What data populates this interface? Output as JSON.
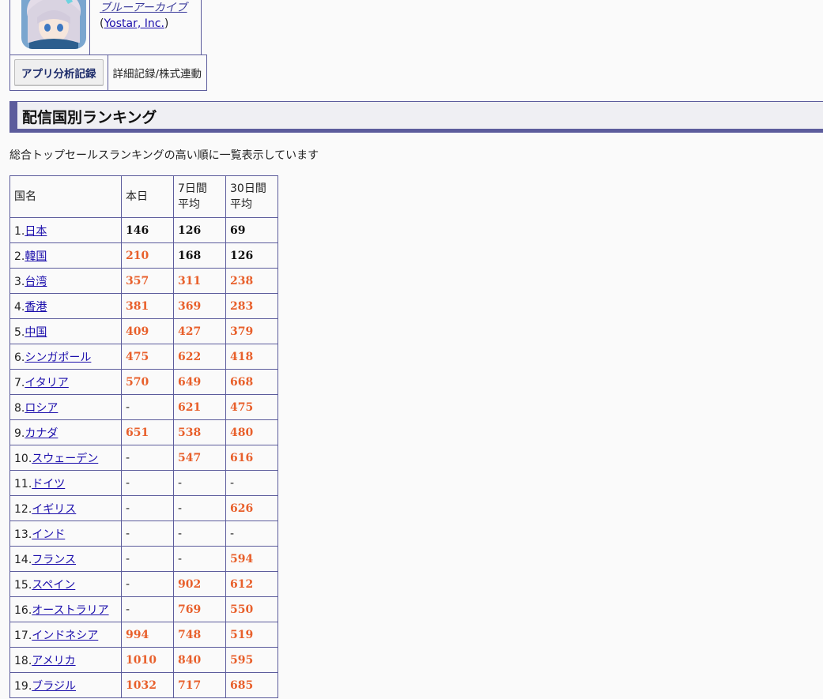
{
  "app": {
    "name": "ブルーアーカイブ",
    "publisher_open": "(",
    "publisher": "Yostar, Inc.",
    "publisher_close": ")"
  },
  "buttons": {
    "analysis_label": "アプリ分析記録",
    "detail_label": "詳細記録/株式連動"
  },
  "section": {
    "title": "配信国別ランキング",
    "description": "総合トップセールスランキングの高い順に一覧表示しています"
  },
  "table": {
    "headers": {
      "country": "国名",
      "today": "本日",
      "avg7_line1": "7日間",
      "avg7_line2": "平均",
      "avg30_line1": "30日間",
      "avg30_line2": "平均"
    },
    "rows": [
      {
        "rank": "1.",
        "country": "日本",
        "today": "146",
        "avg7": "126",
        "avg30": "69"
      },
      {
        "rank": "2.",
        "country": "韓国",
        "today": "210",
        "avg7": "168",
        "avg30": "126"
      },
      {
        "rank": "3.",
        "country": "台湾",
        "today": "357",
        "avg7": "311",
        "avg30": "238"
      },
      {
        "rank": "4.",
        "country": "香港",
        "today": "381",
        "avg7": "369",
        "avg30": "283"
      },
      {
        "rank": "5.",
        "country": "中国",
        "today": "409",
        "avg7": "427",
        "avg30": "379"
      },
      {
        "rank": "6.",
        "country": "シンガポール",
        "today": "475",
        "avg7": "622",
        "avg30": "418"
      },
      {
        "rank": "7.",
        "country": "イタリア",
        "today": "570",
        "avg7": "649",
        "avg30": "668"
      },
      {
        "rank": "8.",
        "country": "ロシア",
        "today": "-",
        "avg7": "621",
        "avg30": "475"
      },
      {
        "rank": "9.",
        "country": "カナダ",
        "today": "651",
        "avg7": "538",
        "avg30": "480"
      },
      {
        "rank": "10.",
        "country": "スウェーデン",
        "today": "-",
        "avg7": "547",
        "avg30": "616"
      },
      {
        "rank": "11.",
        "country": "ドイツ",
        "today": "-",
        "avg7": "-",
        "avg30": "-"
      },
      {
        "rank": "12.",
        "country": "イギリス",
        "today": "-",
        "avg7": "-",
        "avg30": "626"
      },
      {
        "rank": "13.",
        "country": "インド",
        "today": "-",
        "avg7": "-",
        "avg30": "-"
      },
      {
        "rank": "14.",
        "country": "フランス",
        "today": "-",
        "avg7": "-",
        "avg30": "594"
      },
      {
        "rank": "15.",
        "country": "スペイン",
        "today": "-",
        "avg7": "902",
        "avg30": "612"
      },
      {
        "rank": "16.",
        "country": "オーストラリア",
        "today": "-",
        "avg7": "769",
        "avg30": "550"
      },
      {
        "rank": "17.",
        "country": "インドネシア",
        "today": "994",
        "avg7": "748",
        "avg30": "519"
      },
      {
        "rank": "18.",
        "country": "アメリカ",
        "today": "1010",
        "avg7": "840",
        "avg30": "595"
      },
      {
        "rank": "19.",
        "country": "ブラジル",
        "today": "1032",
        "avg7": "717",
        "avg30": "685"
      }
    ]
  },
  "colors": {
    "accent": "#5c5c9c",
    "rank_highlight": "#111111",
    "rank_normal": "#e8602c",
    "link": "#1a0dab"
  }
}
